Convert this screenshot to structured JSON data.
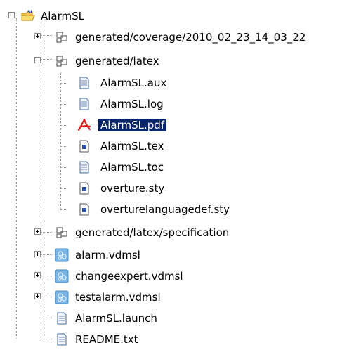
{
  "tree": {
    "root": {
      "label": "AlarmSL",
      "expanded": true,
      "icon": "project-folder-icon"
    },
    "items": [
      {
        "label": "generated/coverage/2010_02_23_14_03_22",
        "icon": "package-folder-icon",
        "expanded": false
      },
      {
        "label": "generated/latex",
        "icon": "package-folder-icon",
        "expanded": true,
        "children": [
          {
            "label": "AlarmSL.aux",
            "icon": "text-file-icon"
          },
          {
            "label": "AlarmSL.log",
            "icon": "text-file-icon"
          },
          {
            "label": "AlarmSL.pdf",
            "icon": "pdf-file-icon",
            "selected": true
          },
          {
            "label": "AlarmSL.tex",
            "icon": "tex-file-icon"
          },
          {
            "label": "AlarmSL.toc",
            "icon": "text-file-icon"
          },
          {
            "label": "overture.sty",
            "icon": "tex-file-icon"
          },
          {
            "label": "overturelanguagedef.sty",
            "icon": "tex-file-icon"
          }
        ]
      },
      {
        "label": "generated/latex/specification",
        "icon": "package-folder-icon",
        "expanded": false
      },
      {
        "label": "alarm.vdmsl",
        "icon": "vdm-file-icon",
        "expanded": false
      },
      {
        "label": "changeexpert.vdmsl",
        "icon": "vdm-file-icon",
        "expanded": false
      },
      {
        "label": "testalarm.vdmsl",
        "icon": "vdm-file-icon",
        "expanded": false
      },
      {
        "label": "AlarmSL.launch",
        "icon": "text-file-icon"
      },
      {
        "label": "README.txt",
        "icon": "text-file-icon"
      }
    ]
  },
  "colors": {
    "selection": "#0a246a",
    "selection_text": "#ffffff",
    "connector": "#a0a0a0"
  }
}
